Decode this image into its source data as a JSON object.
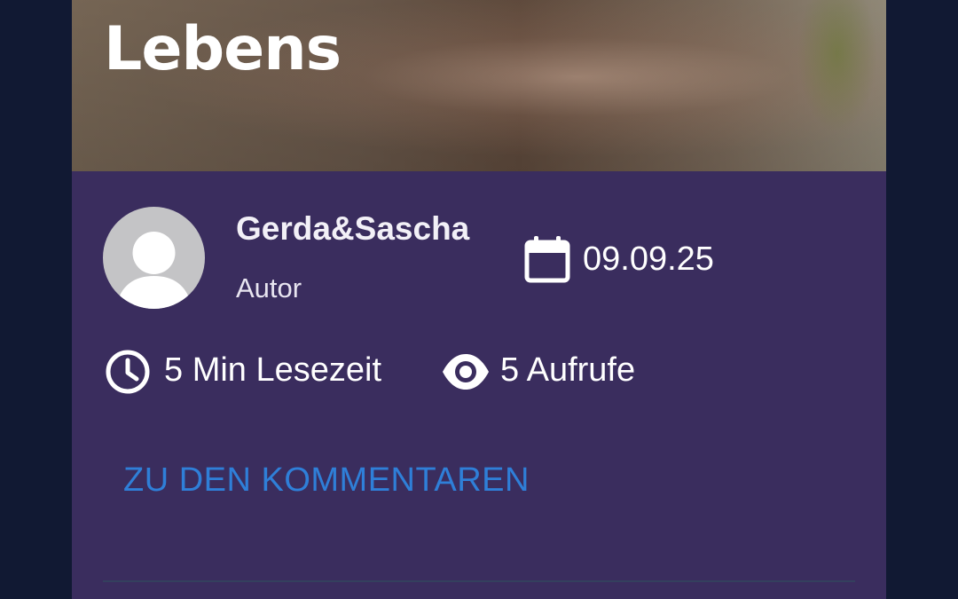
{
  "hero": {
    "title_visible": "Lebens"
  },
  "author": {
    "name": "Gerda&Sascha",
    "role": "Autor"
  },
  "meta": {
    "date": "09.09.25",
    "read_time": "5 Min Lesezeit",
    "views": "5 Aufrufe"
  },
  "comments_link": "ZU DEN KOMMENTAREN",
  "icons": {
    "avatar": "user-placeholder",
    "date": "calendar-icon",
    "read_time": "clock-icon",
    "views": "eye-icon"
  },
  "colors": {
    "page_background": "#111933",
    "card_background": "#3a2d5e",
    "link": "#2f7fd8",
    "text": "#ffffff"
  }
}
